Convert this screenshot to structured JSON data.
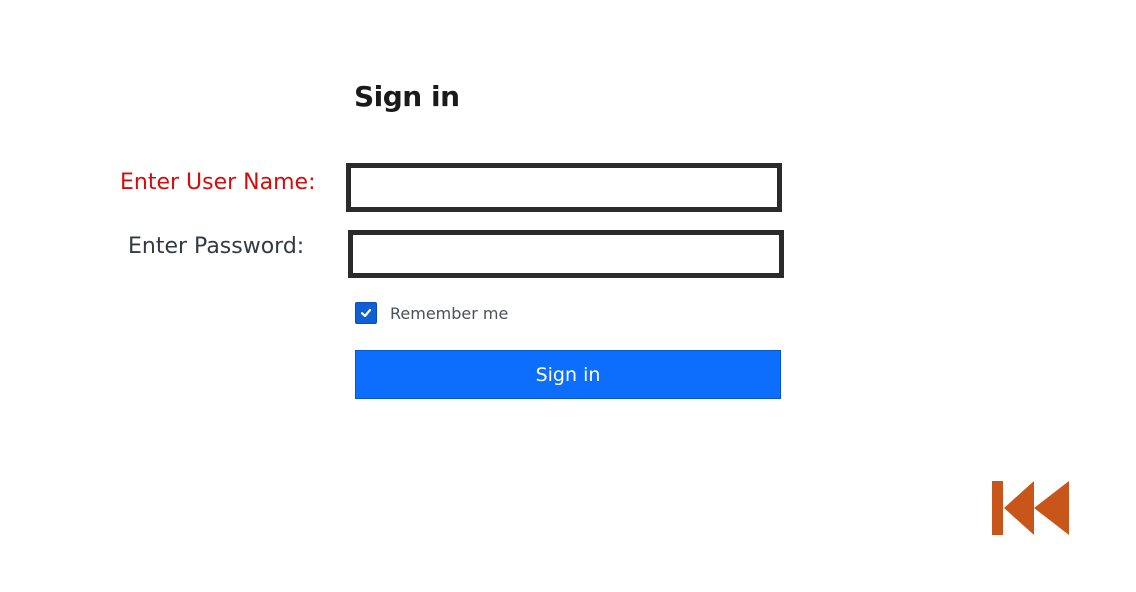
{
  "form": {
    "title": "Sign in",
    "username_label": "Enter User Name:",
    "username_value": "",
    "password_label": "Enter Password:",
    "password_value": "",
    "remember_label": "Remember me",
    "remember_checked": true,
    "submit_label": "Sign in"
  },
  "nav": {
    "rewind_icon": "rewind-to-start-icon"
  },
  "colors": {
    "username_label": "#d40c0c",
    "password_label": "#333a44",
    "button": "#0d6efd",
    "checkbox": "#0f5fd6",
    "rewind_icon": "#c8561a"
  }
}
